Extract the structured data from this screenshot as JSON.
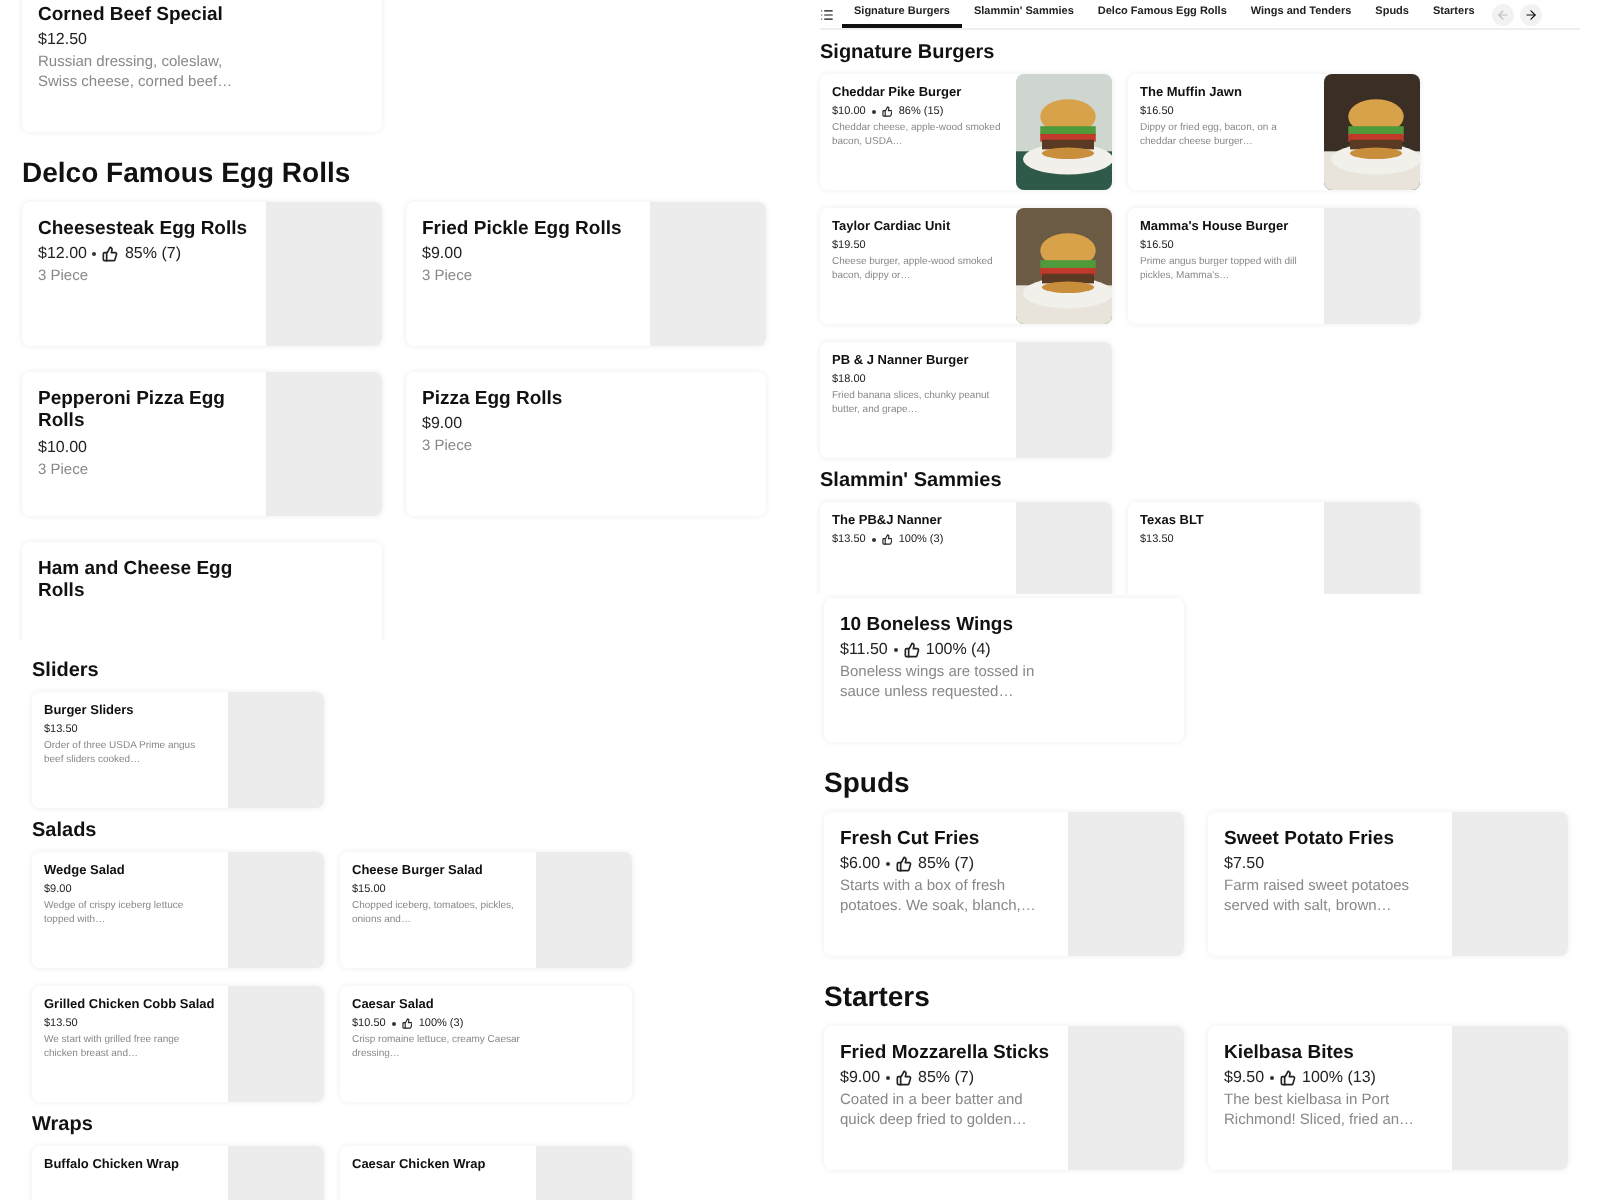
{
  "columns": [
    {
      "panels": [
        {
          "kind": "large",
          "sections": [
            {
              "items": [
                {
                  "name": "Corned Beef Special",
                  "price": "$12.50",
                  "description": "Russian dressing, coleslaw, Swiss cheese, corned beef…"
                }
              ]
            },
            {
              "title": "Delco Famous Egg Rolls",
              "items": [
                {
                  "name": "Cheesesteak Egg Rolls",
                  "price": "$12.00",
                  "rating": "85% (7)",
                  "description": "3 Piece",
                  "kind": "placeholder"
                },
                {
                  "name": "Fried Pickle Egg Rolls",
                  "price": "$9.00",
                  "description": "3 Piece",
                  "kind": "placeholder"
                },
                {
                  "name": "Pepperoni Pizza Egg Rolls",
                  "price": "$10.00",
                  "description": "3 Piece",
                  "kind": "placeholder"
                },
                {
                  "name": "Pizza Egg Rolls",
                  "price": "$9.00",
                  "description": "3 Piece"
                },
                {
                  "name": "Ham and Cheese Egg Rolls"
                }
              ]
            }
          ]
        },
        {
          "kind": "small",
          "sections": [
            {
              "title": "Sliders",
              "items": [
                {
                  "name": "Burger Sliders",
                  "price": "$13.50",
                  "description": "Order of three USDA Prime angus beef sliders cooked…",
                  "kind": "placeholder"
                }
              ]
            },
            {
              "title": "Salads",
              "items": [
                {
                  "name": "Wedge Salad",
                  "price": "$9.00",
                  "description": "Wedge of crispy iceberg lettuce topped with…",
                  "kind": "placeholder"
                },
                {
                  "name": "Cheese Burger Salad",
                  "price": "$15.00",
                  "description": "Chopped iceberg, tomatoes, pickles, onions and…",
                  "kind": "placeholder"
                },
                {
                  "name": "Grilled Chicken Cobb Salad",
                  "price": "$13.50",
                  "description": "We start with grilled free range chicken breast and…",
                  "kind": "placeholder"
                },
                {
                  "name": "Caesar Salad",
                  "price": "$10.50",
                  "rating": "100% (3)",
                  "description": "Crisp romaine lettuce, creamy Caesar dressing…"
                }
              ]
            },
            {
              "title": "Wraps",
              "items": [
                {
                  "name": "Buffalo Chicken Wrap",
                  "kind": "placeholder"
                },
                {
                  "name": "Caesar Chicken Wrap",
                  "kind": "placeholder"
                }
              ]
            }
          ]
        }
      ]
    },
    {
      "panels": [
        {
          "kind": "small",
          "tabs": {
            "items": [
              {
                "label": "Signature Burgers",
                "selected": true
              },
              {
                "label": "Slammin' Sammies",
                "selected": false
              },
              {
                "label": "Delco Famous Egg Rolls",
                "selected": false
              },
              {
                "label": "Wings and Tenders",
                "selected": false
              },
              {
                "label": "Spuds",
                "selected": false
              },
              {
                "label": "Starters",
                "selected": false
              }
            ],
            "back_disabled": true
          },
          "sections": [
            {
              "title": "Signature Burgers",
              "items": [
                {
                  "name": "Cheddar Pike Burger",
                  "price": "$10.00",
                  "rating": "86% (15)",
                  "description": "Cheddar cheese, apple-wood smoked bacon, USDA…",
                  "kind": "picture"
                },
                {
                  "name": "The Muffin Jawn",
                  "price": "$16.50",
                  "description": "Dippy or fried egg, bacon, on a cheddar cheese burger…",
                  "kind": "picture"
                },
                {
                  "name": "Taylor Cardiac Unit",
                  "price": "$19.50",
                  "description": "Cheese burger, apple-wood smoked bacon, dippy or…",
                  "kind": "picture"
                },
                {
                  "name": "Mamma's House Burger",
                  "price": "$16.50",
                  "description": "Prime angus burger topped with dill pickles, Mamma's…",
                  "kind": "placeholder"
                },
                {
                  "name": "PB & J Nanner Burger",
                  "price": "$18.00",
                  "description": "Fried banana slices, chunky peanut butter, and grape…",
                  "kind": "placeholder"
                }
              ]
            },
            {
              "title": "Slammin' Sammies",
              "items": [
                {
                  "name": "The PB&J Nanner",
                  "price": "$13.50",
                  "rating": "100% (3)",
                  "kind": "placeholder"
                },
                {
                  "name": "Texas BLT",
                  "price": "$13.50",
                  "kind": "placeholder"
                }
              ]
            }
          ]
        },
        {
          "kind": "large",
          "sections": [
            {
              "items": [
                {
                  "name": "10 Boneless Wings",
                  "price": "$11.50",
                  "rating": "100% (4)",
                  "description": "Boneless wings are tossed in sauce unless requested…"
                }
              ]
            },
            {
              "title": "Spuds",
              "items": [
                {
                  "name": "Fresh Cut Fries",
                  "price": "$6.00",
                  "rating": "85% (7)",
                  "description": "Starts with a box of fresh potatoes. We soak, blanch,…",
                  "kind": "placeholder"
                },
                {
                  "name": "Sweet Potato Fries",
                  "price": "$7.50",
                  "description": "Farm raised sweet potatoes served with salt, brown…",
                  "kind": "placeholder"
                }
              ]
            },
            {
              "title": "Starters",
              "items": [
                {
                  "name": "Fried Mozzarella Sticks",
                  "price": "$9.00",
                  "rating": "85% (7)",
                  "description": "Coated in a beer batter and quick deep fried to golden…",
                  "kind": "placeholder"
                },
                {
                  "name": "Kielbasa Bites",
                  "price": "$9.50",
                  "rating": "100% (13)",
                  "description": "The best kielbasa in Port Richmond! Sliced, fried an…",
                  "kind": "placeholder"
                }
              ]
            }
          ]
        }
      ]
    }
  ]
}
